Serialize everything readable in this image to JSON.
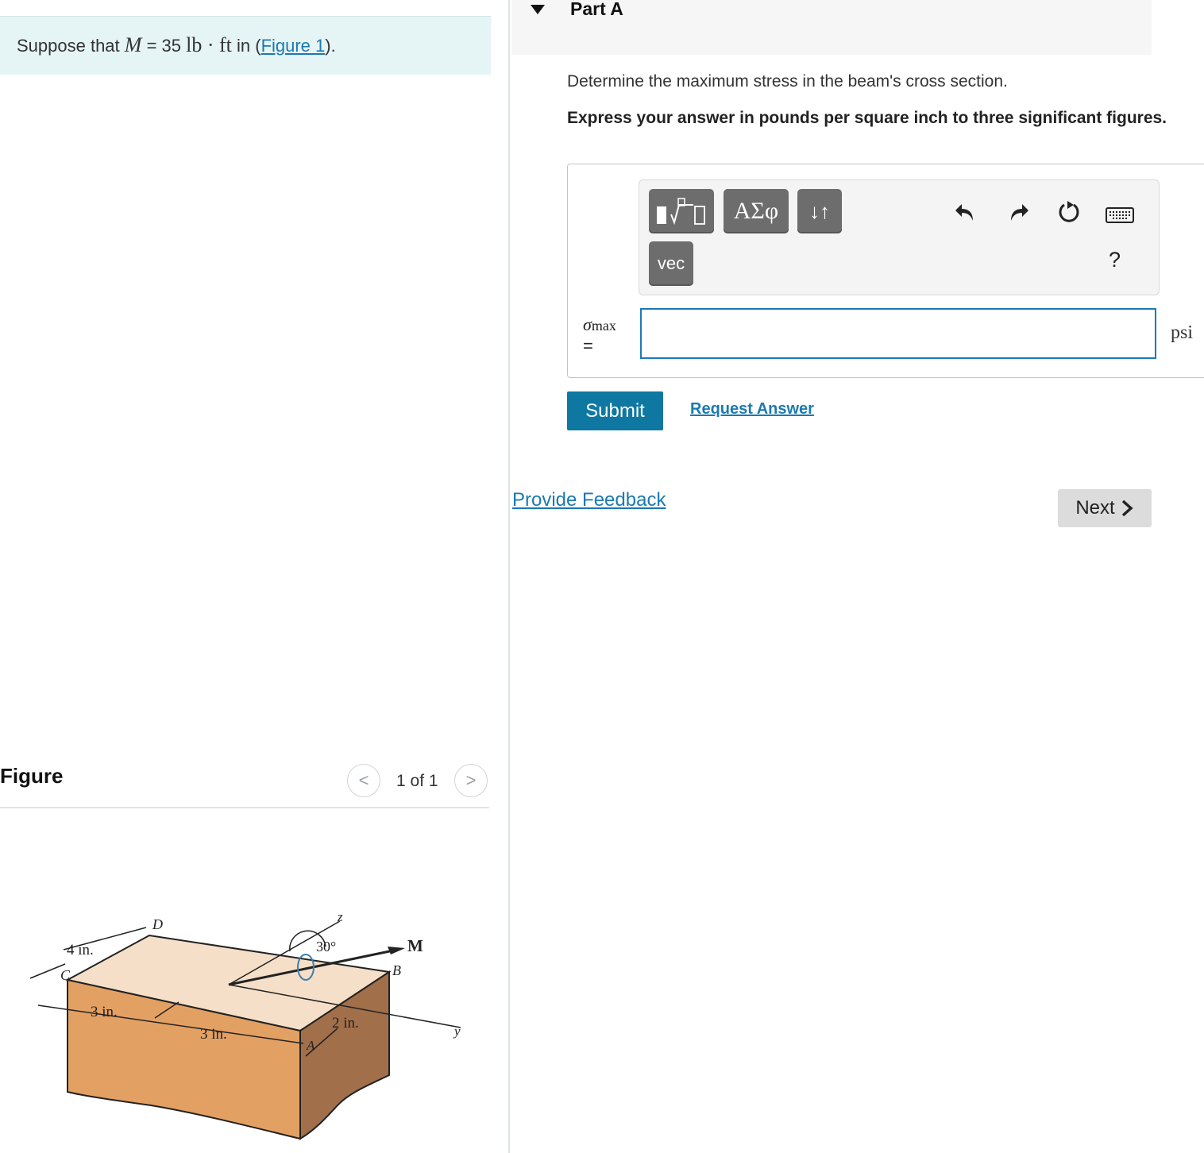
{
  "problem": {
    "prefix": "Suppose that ",
    "variable": "M",
    "equals_value": " = 35 ",
    "units": "lb · ft",
    "middle": " in (",
    "figure_link": "Figure 1",
    "suffix": ")."
  },
  "figure_panel": {
    "title": "Figure",
    "pager_text": "1 of 1",
    "prev_glyph": "<",
    "next_glyph": ">",
    "labels": {
      "dim_4in": "4 in.",
      "point_c": "C",
      "point_d": "D",
      "dim_3in_left": "3 in.",
      "dim_3in_mid": "3 in.",
      "point_a": "A",
      "dim_2in": "2 in.",
      "axis_z": "z",
      "angle": "30°",
      "moment": "M",
      "point_b": "B",
      "axis_y": "y"
    },
    "colors": {
      "top_face": "#f5dfc8",
      "front_face": "#e3a063",
      "side_face": "#a26f4b"
    }
  },
  "part_a": {
    "title": "Part A",
    "question": "Determine the maximum stress in the beam's cross section.",
    "instruction": "Express your answer in pounds per square inch to three significant figures."
  },
  "toolbar": {
    "greek_label": "ΑΣφ",
    "arrows_label": "↓↑",
    "vec_label": "vec",
    "help_label": "?",
    "icons": [
      "templates-icon",
      "undo-icon",
      "redo-icon",
      "reset-icon",
      "keyboard-icon"
    ]
  },
  "answer": {
    "symbol": "σ",
    "subscript": "max",
    "equals": "=",
    "value": "",
    "unit": "psi"
  },
  "actions": {
    "submit_label": "Submit",
    "request_answer_label": "Request Answer",
    "provide_feedback_label": "Provide Feedback",
    "next_label": "Next"
  },
  "colors": {
    "banner_bg": "#e5f4f5",
    "link": "#1a7ab0",
    "submit_bg": "#0e78a2",
    "input_border": "#1b7ab5",
    "toolbar_button": "#6d6d6d",
    "next_bg": "#dcdcdc"
  }
}
